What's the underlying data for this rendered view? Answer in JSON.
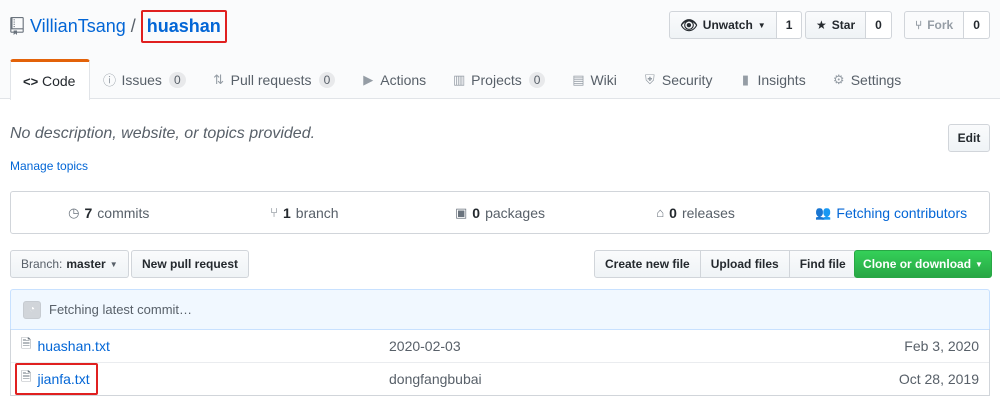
{
  "repo": {
    "owner": "VillianTsang",
    "separator": "/",
    "name": "huashan"
  },
  "actions": {
    "watch": {
      "label": "Unwatch",
      "count": "1"
    },
    "star": {
      "label": "Star",
      "count": "0"
    },
    "fork": {
      "label": "Fork",
      "count": "0"
    }
  },
  "tabs": [
    {
      "label": "Code",
      "icon": "code-icon",
      "glyph": "<>"
    },
    {
      "label": "Issues",
      "count": "0",
      "icon": "issue-icon",
      "glyph": "ⓘ"
    },
    {
      "label": "Pull requests",
      "count": "0",
      "icon": "pull-request-icon",
      "glyph": "⇅"
    },
    {
      "label": "Actions",
      "icon": "play-icon",
      "glyph": "▶"
    },
    {
      "label": "Projects",
      "count": "0",
      "icon": "project-icon",
      "glyph": "▥"
    },
    {
      "label": "Wiki",
      "icon": "book-icon",
      "glyph": "▤"
    },
    {
      "label": "Security",
      "icon": "shield-icon",
      "glyph": "⛨"
    },
    {
      "label": "Insights",
      "icon": "graph-icon",
      "glyph": "▮"
    },
    {
      "label": "Settings",
      "icon": "gear-icon",
      "glyph": "⚙"
    }
  ],
  "description": {
    "text": "No description, website, or topics provided.",
    "edit_label": "Edit",
    "manage_topics": "Manage topics"
  },
  "summary": {
    "commits": {
      "count": "7",
      "label": "commits",
      "icon": "history-icon"
    },
    "branch": {
      "count": "1",
      "label": "branch",
      "icon": "git-branch-icon"
    },
    "packages": {
      "count": "0",
      "label": "packages",
      "icon": "package-icon"
    },
    "releases": {
      "count": "0",
      "label": "releases",
      "icon": "tag-icon"
    },
    "contributors": {
      "label": "Fetching contributors",
      "icon": "people-icon"
    }
  },
  "file_nav": {
    "branch_prefix": "Branch:",
    "branch_name": "master",
    "new_pr": "New pull request",
    "create_file": "Create new file",
    "upload_files": "Upload files",
    "find_file": "Find file",
    "clone": "Clone or download"
  },
  "commit_tease": "Fetching latest commit…",
  "files": [
    {
      "name": "huashan.txt",
      "message": "2020-02-03",
      "age": "Feb 3, 2020"
    },
    {
      "name": "jianfa.txt",
      "message": "dongfangbubai",
      "age": "Oct 28, 2019"
    }
  ],
  "colors": {
    "link": "#0366d6",
    "highlight": "#e02020",
    "tab_accent": "#e36209",
    "primary_button": "#28a745"
  }
}
